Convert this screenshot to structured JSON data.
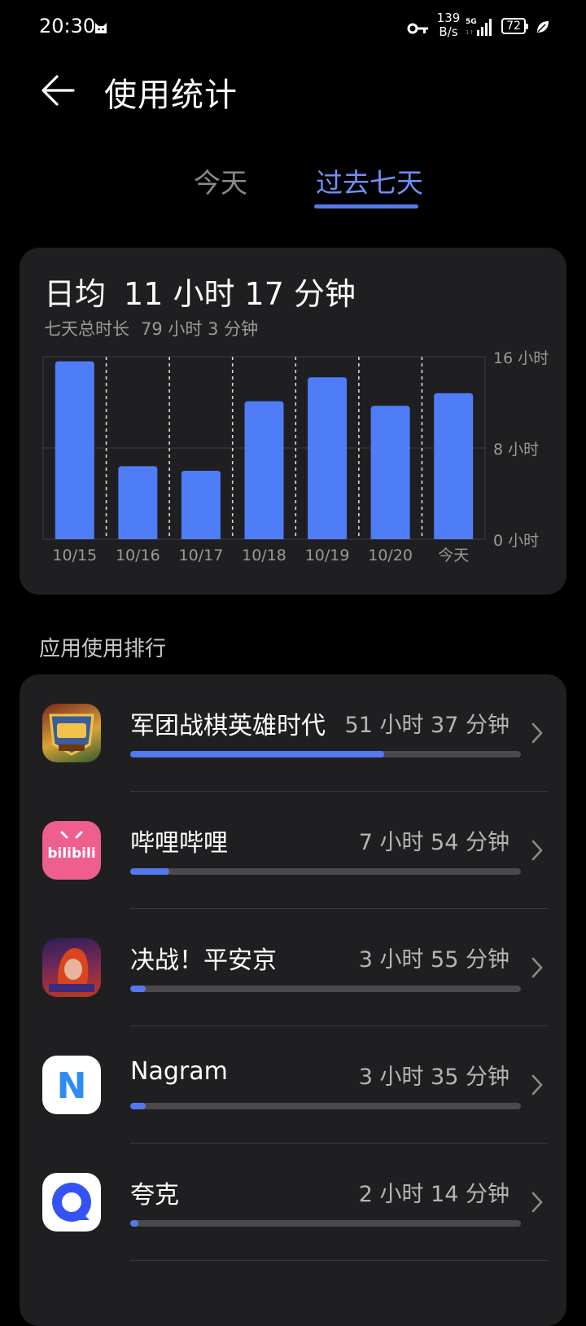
{
  "status_bar": {
    "time": "20:30",
    "net_speed_value": "139",
    "net_speed_unit": "B/s",
    "battery_level": "72",
    "icons": [
      "cat-icon",
      "key-icon",
      "signal-icon",
      "battery-icon",
      "leaf-icon"
    ]
  },
  "header": {
    "back_icon": "back-arrow-icon",
    "title": "使用统计"
  },
  "tabs": [
    {
      "label": "今天",
      "selected": false
    },
    {
      "label": "过去七天",
      "selected": true
    }
  ],
  "summary": {
    "avg_label": "日均",
    "avg_value": "11 小时 17 分钟",
    "total_label": "七天总时长",
    "total_value": "79 小时 3 分钟"
  },
  "chart_data": {
    "type": "bar",
    "categories": [
      "10/15",
      "10/16",
      "10/17",
      "10/18",
      "10/19",
      "10/20",
      "今天"
    ],
    "values": [
      15.6,
      6.4,
      6.0,
      12.1,
      14.2,
      11.7,
      12.8
    ],
    "ylim": [
      0,
      16
    ],
    "yticks": [
      0,
      8,
      16
    ],
    "ytick_labels": [
      "0 小时",
      "8 小时",
      "16 小时"
    ],
    "unit": "小时",
    "bar_color": "#4f7cf7",
    "grid": true
  },
  "section_title": "应用使用排行",
  "apps": [
    {
      "name": "军团战棋英雄时代",
      "time": "51 小时 37 分钟",
      "progress": 0.65,
      "icon": "game-icon"
    },
    {
      "name": "哔哩哔哩",
      "time": "7 小时 54 分钟",
      "progress": 0.1,
      "icon": "bilibili-icon",
      "icon_text": "bilibili"
    },
    {
      "name": "决战！平安京",
      "time": "3 小时 55 分钟",
      "progress": 0.04,
      "icon": "game-icon"
    },
    {
      "name": "Nagram",
      "time": "3 小时 35 分钟",
      "progress": 0.04,
      "icon": "nagram-icon",
      "icon_text": "N"
    },
    {
      "name": "夸克",
      "time": "2 小时 14 分钟",
      "progress": 0.02,
      "icon": "quark-icon"
    }
  ],
  "colors": {
    "accent": "#5478f0",
    "card_bg": "#1f1f21",
    "track": "#4a4a4c",
    "muted_text": "#9a9a9a"
  }
}
